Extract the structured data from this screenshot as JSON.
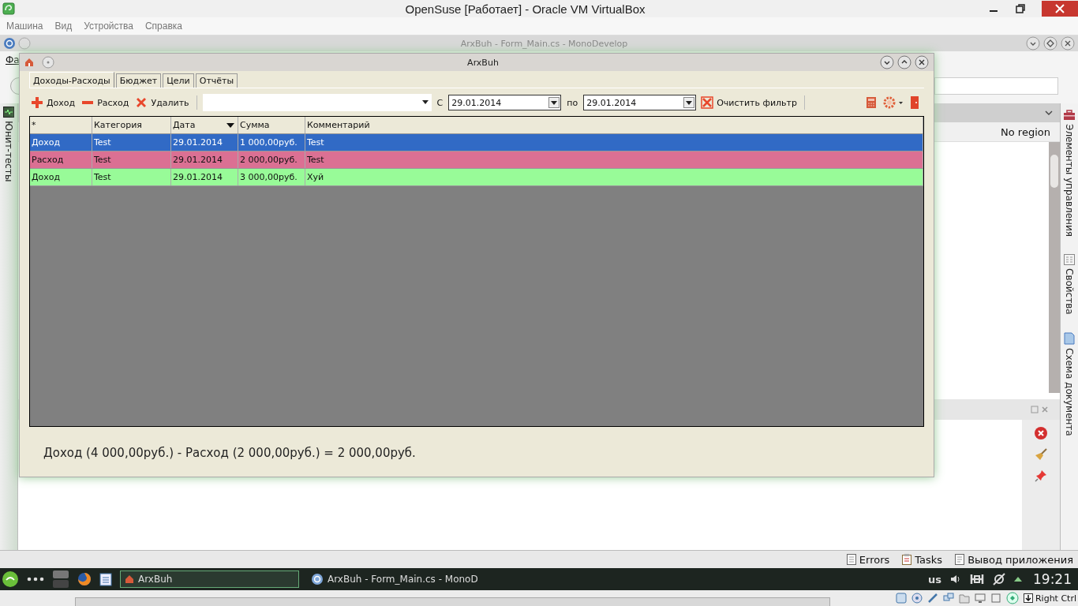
{
  "vbox": {
    "title": "OpenSuse [Работает] - Oracle VM VirtualBox",
    "menu": [
      "Машина",
      "Вид",
      "Устройства",
      "Справка"
    ]
  },
  "ide": {
    "title": "ArxBuh - Form_Main.cs - MonoDevelop",
    "menu_fragment": "Фа",
    "left_pads": [
      "Юнит-тесты"
    ],
    "region": "No region",
    "right_pads": [
      {
        "label": "Элементы управления",
        "kind": "toolbox"
      },
      {
        "label": "Свойства",
        "kind": "properties"
      },
      {
        "label": "Схема документа",
        "kind": "outline"
      }
    ],
    "bottom_pads": [
      {
        "label": "Errors",
        "kind": "errors"
      },
      {
        "label": "Tasks",
        "kind": "tasks"
      },
      {
        "label": "Вывод приложения",
        "kind": "output"
      }
    ]
  },
  "app": {
    "title": "ArxBuh",
    "tabs": [
      {
        "label": "Доходы-Расходы",
        "selected": true
      },
      {
        "label": "Бюджет",
        "selected": false
      },
      {
        "label": "Цели",
        "selected": false
      },
      {
        "label": "Отчёты",
        "selected": false
      }
    ],
    "toolbar": {
      "add_income": "Доход",
      "add_expense": "Расход",
      "delete": "Удалить",
      "from_label": "С",
      "date_from": "29.01.2014",
      "to_label": "по",
      "date_to": "29.01.2014",
      "clear_filter": "Очистить фильтр"
    },
    "table": {
      "columns": [
        {
          "label": "*",
          "sorted": false
        },
        {
          "label": "Категория",
          "sorted": false
        },
        {
          "label": "Дата",
          "sorted": true
        },
        {
          "label": "Сумма",
          "sorted": false
        },
        {
          "label": "Комментарий",
          "sorted": false
        }
      ],
      "rows": [
        {
          "cells": [
            "Доход",
            "Test",
            "29.01.2014",
            "1 000,00руб.",
            "Test"
          ],
          "color": "#316ac5",
          "selected": true
        },
        {
          "cells": [
            "Расход",
            "Test",
            "29.01.2014",
            "2 000,00руб.",
            "Test"
          ],
          "color": "#db7093",
          "selected": false
        },
        {
          "cells": [
            "Доход",
            "Test",
            "29.01.2014",
            "3 000,00руб.",
            "Хуй"
          ],
          "color": "#98fb98",
          "selected": false
        }
      ]
    },
    "summary": "Доход (4 000,00руб.) - Расход (2 000,00руб.) = 2 000,00руб."
  },
  "taskbar": {
    "tasks": [
      {
        "label": "ArxBuh",
        "kind": "home",
        "selected": true
      },
      {
        "label": "ArxBuh - Form_Main.cs - MonoD",
        "kind": "mono",
        "selected": false
      }
    ],
    "keyboard": "us",
    "clock": "19:21"
  },
  "statusbar": {
    "host_key": "Right Ctrl"
  }
}
